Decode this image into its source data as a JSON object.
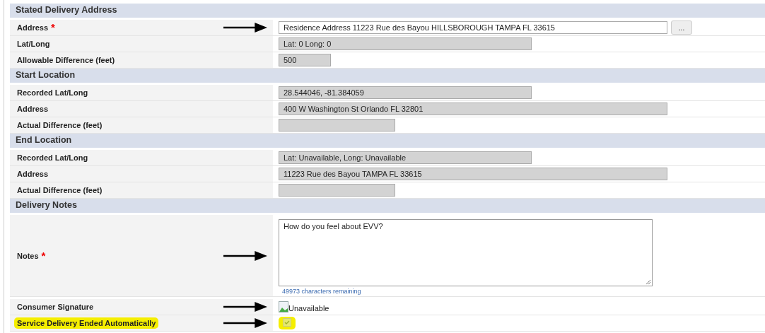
{
  "sections": [
    {
      "title": "Stated Delivery Address",
      "rows": [
        {
          "label": "Address",
          "required": "*",
          "kind": "input",
          "value": "Residence Address 11223 Rue des Bayou HILLSBOROUGH TAMPA FL 33615",
          "button": "...",
          "arrow": true,
          "highlighted": false
        },
        {
          "label": "Lat/Long",
          "kind": "readonly",
          "value": "Lat: 0 Long: 0",
          "arrow": false,
          "highlighted": false
        },
        {
          "label": "Allowable Difference (feet)",
          "kind": "readonly",
          "value": "500",
          "arrow": false,
          "highlighted": false
        }
      ]
    },
    {
      "title": "Start Location",
      "rows": [
        {
          "label": "Recorded Lat/Long",
          "kind": "readonly",
          "value": "28.544046, -81.384059",
          "arrow": false,
          "highlighted": false
        },
        {
          "label": "Address",
          "kind": "readonly",
          "value": "400 W Washington St Orlando FL 32801",
          "arrow": false,
          "highlighted": false
        },
        {
          "label": "Actual Difference (feet)",
          "kind": "readonly",
          "arrow": false,
          "highlighted": false
        }
      ]
    },
    {
      "title": "End Location",
      "rows": [
        {
          "label": "Recorded Lat/Long",
          "kind": "readonly",
          "value": "Lat: Unavailable, Long: Unavailable",
          "arrow": false,
          "highlighted": false
        },
        {
          "label": "Address",
          "kind": "readonly",
          "value": "11223 Rue des Bayou TAMPA FL 33615",
          "arrow": false,
          "highlighted": false
        },
        {
          "label": "Actual Difference (feet)",
          "kind": "readonly",
          "arrow": false,
          "highlighted": false
        }
      ]
    },
    {
      "title": "Delivery Notes",
      "rows": [
        {
          "label": "Notes",
          "required": "*",
          "kind": "textarea",
          "value": "How do you feel about EVV?",
          "hint": "49973 characters remaining",
          "arrow": true,
          "highlighted": false
        },
        {
          "label": "Consumer Signature",
          "kind": "image",
          "value": "Unavailable",
          "arrow": true,
          "highlighted": false
        },
        {
          "label": "Service Delivery Ended Automatically",
          "kind": "checkbox",
          "checked": true,
          "arrow": true,
          "highlighted": true
        }
      ]
    }
  ]
}
